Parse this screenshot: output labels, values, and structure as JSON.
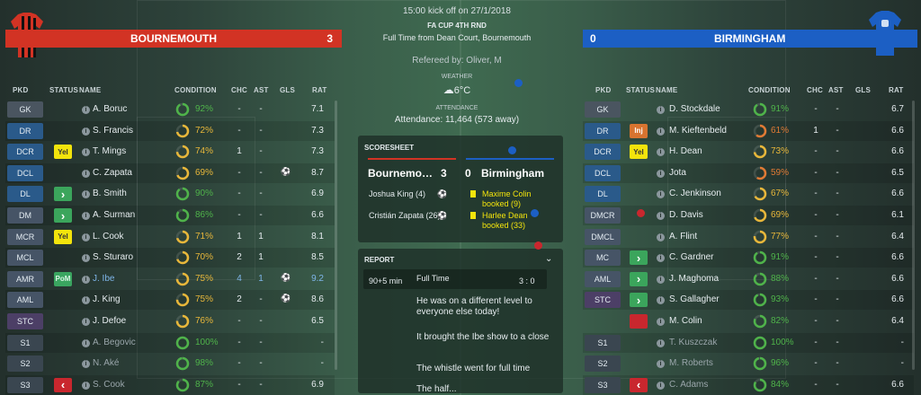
{
  "match": {
    "kickoff": "15:00 kick off on 27/1/2018",
    "competition": "FA CUP 4TH RND",
    "status": "Full Time from Dean Court, Bournemouth",
    "referee": "Refereed by: Oliver, M",
    "weather_label": "WEATHER",
    "weather_value": "6°C",
    "attendance_label": "ATTENDANCE",
    "attendance_value": "Attendance: 11,464 (573 away)"
  },
  "home": {
    "name": "BOURNEMOUTH",
    "score": "3",
    "color": "#d23324"
  },
  "away": {
    "name": "BIRMINGHAM",
    "score": "0",
    "color": "#1c5fc4"
  },
  "columns": {
    "pkd": "PKD",
    "status": "STATUS",
    "name": "NAME",
    "condition": "CONDITION",
    "chc": "CHC",
    "ast": "AST",
    "gls": "GLS",
    "rat": "RAT"
  },
  "home_players": [
    {
      "pos": "GK",
      "type": "gk",
      "name": "A. Boruc",
      "status": "",
      "cond": 92,
      "cond_text": "92%",
      "chc": "-",
      "ast": "-",
      "gls": "",
      "rat": "7.1"
    },
    {
      "pos": "DR",
      "type": "def",
      "name": "S. Francis",
      "status": "",
      "cond": 72,
      "cond_text": "72%",
      "chc": "-",
      "ast": "-",
      "gls": "",
      "rat": "7.3"
    },
    {
      "pos": "DCR",
      "type": "def",
      "name": "T. Mings",
      "status": "Yel",
      "cond": 74,
      "cond_text": "74%",
      "chc": "1",
      "ast": "-",
      "gls": "",
      "rat": "7.3"
    },
    {
      "pos": "DCL",
      "type": "def",
      "name": "C. Zapata",
      "status": "",
      "cond": 69,
      "cond_text": "69%",
      "chc": "-",
      "ast": "-",
      "gls": "ball",
      "rat": "8.7"
    },
    {
      "pos": "DL",
      "type": "def",
      "name": "B. Smith",
      "status": "up",
      "cond": 90,
      "cond_text": "90%",
      "chc": "-",
      "ast": "-",
      "gls": "",
      "rat": "6.9"
    },
    {
      "pos": "DM",
      "type": "mid",
      "name": "A. Surman",
      "status": "up",
      "cond": 86,
      "cond_text": "86%",
      "chc": "-",
      "ast": "-",
      "gls": "",
      "rat": "6.6"
    },
    {
      "pos": "MCR",
      "type": "mid",
      "name": "L. Cook",
      "status": "Yel",
      "cond": 71,
      "cond_text": "71%",
      "chc": "1",
      "ast": "1",
      "gls": "",
      "rat": "8.1"
    },
    {
      "pos": "MCL",
      "type": "mid",
      "name": "S. Sturaro",
      "status": "",
      "cond": 70,
      "cond_text": "70%",
      "chc": "2",
      "ast": "1",
      "gls": "",
      "rat": "8.5"
    },
    {
      "pos": "AMR",
      "type": "mid",
      "name": "J. Ibe",
      "status": "PoM",
      "cond": 75,
      "cond_text": "75%",
      "chc": "4",
      "ast": "1",
      "gls": "ball",
      "rat": "9.2",
      "highlight": true
    },
    {
      "pos": "AML",
      "type": "mid",
      "name": "J. King",
      "status": "",
      "cond": 75,
      "cond_text": "75%",
      "chc": "2",
      "ast": "-",
      "gls": "ball",
      "rat": "8.6"
    },
    {
      "pos": "STC",
      "type": "fwd",
      "name": "J. Defoe",
      "status": "",
      "cond": 76,
      "cond_text": "76%",
      "chc": "-",
      "ast": "-",
      "gls": "",
      "rat": "6.5"
    },
    {
      "pos": "S1",
      "type": "sub",
      "name": "A. Begovic",
      "status": "",
      "cond": 100,
      "cond_text": "100%",
      "chc": "-",
      "ast": "-",
      "gls": "",
      "rat": "-",
      "dim": true
    },
    {
      "pos": "S2",
      "type": "sub",
      "name": "N. Aké",
      "status": "",
      "cond": 98,
      "cond_text": "98%",
      "chc": "-",
      "ast": "-",
      "gls": "",
      "rat": "-",
      "dim": true
    },
    {
      "pos": "S3",
      "type": "sub",
      "name": "S. Cook",
      "status": "down",
      "cond": 87,
      "cond_text": "87%",
      "chc": "-",
      "ast": "-",
      "gls": "",
      "rat": "6.9",
      "dim": true
    }
  ],
  "away_players": [
    {
      "pos": "GK",
      "type": "gk",
      "name": "D. Stockdale",
      "status": "",
      "cond": 91,
      "cond_text": "91%",
      "chc": "-",
      "ast": "-",
      "gls": "",
      "rat": "6.7"
    },
    {
      "pos": "DR",
      "type": "def",
      "name": "M. Kieftenbeld",
      "status": "Inj",
      "cond": 61,
      "cond_text": "61%",
      "chc": "1",
      "ast": "-",
      "gls": "",
      "rat": "6.6"
    },
    {
      "pos": "DCR",
      "type": "def",
      "name": "H. Dean",
      "status": "Yel",
      "cond": 73,
      "cond_text": "73%",
      "chc": "-",
      "ast": "-",
      "gls": "",
      "rat": "6.6"
    },
    {
      "pos": "DCL",
      "type": "def",
      "name": "Jota",
      "status": "",
      "cond": 59,
      "cond_text": "59%",
      "chc": "-",
      "ast": "-",
      "gls": "",
      "rat": "6.5"
    },
    {
      "pos": "DL",
      "type": "def",
      "name": "C. Jenkinson",
      "status": "",
      "cond": 67,
      "cond_text": "67%",
      "chc": "-",
      "ast": "-",
      "gls": "",
      "rat": "6.6"
    },
    {
      "pos": "DMCR",
      "type": "mid",
      "name": "D. Davis",
      "status": "",
      "cond": 69,
      "cond_text": "69%",
      "chc": "-",
      "ast": "-",
      "gls": "",
      "rat": "6.1"
    },
    {
      "pos": "DMCL",
      "type": "mid",
      "name": "A. Flint",
      "status": "",
      "cond": 77,
      "cond_text": "77%",
      "chc": "-",
      "ast": "-",
      "gls": "",
      "rat": "6.4"
    },
    {
      "pos": "MC",
      "type": "mid",
      "name": "C. Gardner",
      "status": "up",
      "cond": 91,
      "cond_text": "91%",
      "chc": "-",
      "ast": "-",
      "gls": "",
      "rat": "6.6"
    },
    {
      "pos": "AML",
      "type": "mid",
      "name": "J. Maghoma",
      "status": "up",
      "cond": 88,
      "cond_text": "88%",
      "chc": "-",
      "ast": "-",
      "gls": "",
      "rat": "6.6"
    },
    {
      "pos": "STC",
      "type": "fwd",
      "name": "S. Gallagher",
      "status": "up",
      "cond": 93,
      "cond_text": "93%",
      "chc": "-",
      "ast": "-",
      "gls": "",
      "rat": "6.6"
    },
    {
      "pos": "",
      "type": "none",
      "name": "M. Colin",
      "status": "red",
      "cond": 82,
      "cond_text": "82%",
      "chc": "-",
      "ast": "-",
      "gls": "",
      "rat": "6.4"
    },
    {
      "pos": "S1",
      "type": "sub",
      "name": "T. Kuszczak",
      "status": "",
      "cond": 100,
      "cond_text": "100%",
      "chc": "-",
      "ast": "-",
      "gls": "",
      "rat": "-",
      "dim": true
    },
    {
      "pos": "S2",
      "type": "sub",
      "name": "M. Roberts",
      "status": "",
      "cond": 96,
      "cond_text": "96%",
      "chc": "-",
      "ast": "-",
      "gls": "",
      "rat": "-",
      "dim": true
    },
    {
      "pos": "S3",
      "type": "sub",
      "name": "C. Adams",
      "status": "down",
      "cond": 84,
      "cond_text": "84%",
      "chc": "-",
      "ast": "-",
      "gls": "",
      "rat": "6.6",
      "dim": true
    }
  ],
  "scoresheet": {
    "title": "SCORESHEET",
    "home_name": "Bournemo…",
    "home_score": "3",
    "away_score": "0",
    "away_name": "Birmingham",
    "home_events": [
      {
        "text": "Joshua King (4)",
        "icon": "ball"
      },
      {
        "text": "Cristián Zapata (26)",
        "icon": "ball"
      }
    ],
    "away_events": [
      {
        "text": "Maxime Colin booked (9)",
        "icon": "yellow-card"
      },
      {
        "text": "Harlee Dean booked (33)",
        "icon": "yellow-card"
      }
    ]
  },
  "report": {
    "title": "REPORT",
    "time": "90+5 min",
    "event": "Full Time",
    "score": "3 : 0",
    "lines": [
      "He was on a different level to everyone else today!",
      "It brought the Ibe show to a close",
      "The whistle went for full time",
      "The half..."
    ]
  },
  "colors": {
    "yellow": "#f3e40c",
    "green": "#3ba55c",
    "red": "#c9272e",
    "condition_high": "#4fb34a",
    "condition_mid": "#e8b73a",
    "condition_low": "#e07a34"
  }
}
